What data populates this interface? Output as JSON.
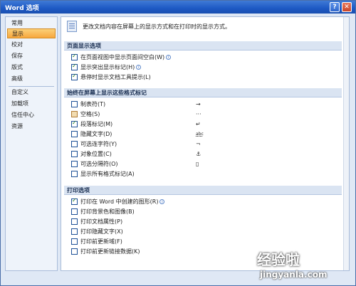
{
  "window": {
    "title": "Word 选项",
    "help_label": "?",
    "close_label": "✕"
  },
  "sidebar": {
    "items": [
      {
        "label": "常用"
      },
      {
        "label": "显示"
      },
      {
        "label": "校对"
      },
      {
        "label": "保存"
      },
      {
        "label": "版式"
      },
      {
        "label": "高级"
      },
      {
        "label": "自定义"
      },
      {
        "label": "加载项"
      },
      {
        "label": "信任中心"
      },
      {
        "label": "资源"
      }
    ],
    "active": "显示"
  },
  "content": {
    "header_text": "更改文档内容在屏幕上的显示方式和在打印时的显示方式。",
    "sections": [
      {
        "title": "页面显示选项",
        "options": [
          {
            "label": "在页面视图中显示页面间空白(W)",
            "checked": true,
            "info": true
          },
          {
            "label": "显示突出显示标记(H)",
            "checked": true,
            "info": true
          },
          {
            "label": "悬停时显示文档工具提示(L)",
            "checked": true,
            "info": false
          }
        ]
      },
      {
        "title": "始终在屏幕上显示这些格式标记",
        "options": [
          {
            "label": "制表符(T)",
            "checked": false,
            "symbol": "→"
          },
          {
            "label": "空格(S)",
            "checked": false,
            "partial": true,
            "symbol": "···"
          },
          {
            "label": "段落标记(M)",
            "checked": true,
            "symbol": "↵"
          },
          {
            "label": "隐藏文字(D)",
            "checked": false,
            "symbol": "abc"
          },
          {
            "label": "可选连字符(Y)",
            "checked": false,
            "symbol": "¬"
          },
          {
            "label": "对象位置(C)",
            "checked": false,
            "symbol": "⚓"
          },
          {
            "label": "可选分隔符(O)",
            "checked": false,
            "symbol": "▯"
          },
          {
            "label": "显示所有格式标记(A)",
            "checked": false,
            "symbol": ""
          }
        ]
      },
      {
        "title": "打印选项",
        "options": [
          {
            "label": "打印在 Word 中创建的图形(R)",
            "checked": true,
            "info": true
          },
          {
            "label": "打印背景色和图像(B)",
            "checked": false
          },
          {
            "label": "打印文档属性(P)",
            "checked": false
          },
          {
            "label": "打印隐藏文字(X)",
            "checked": false
          },
          {
            "label": "打印前更新域(F)",
            "checked": false
          },
          {
            "label": "打印前更新链接数据(K)",
            "checked": false
          }
        ]
      }
    ]
  },
  "watermark": {
    "main": "经验啦",
    "url": "jingyanla.com"
  }
}
